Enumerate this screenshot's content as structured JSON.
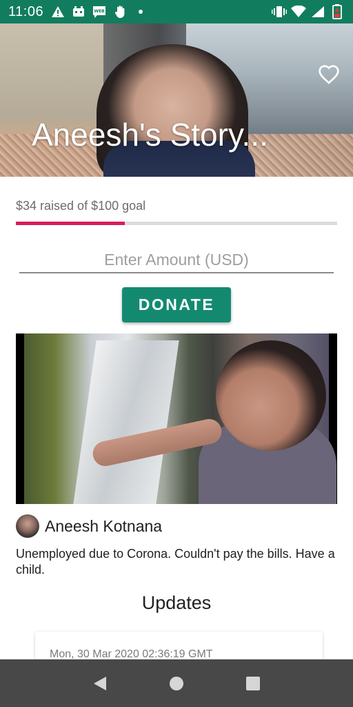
{
  "status_bar": {
    "time": "11:06",
    "left_icons": [
      "alert-icon",
      "bot-icon",
      "webtoon-icon",
      "hand-icon",
      "dot-icon"
    ],
    "right_icons": [
      "vibrate-icon",
      "wifi-icon",
      "signal-icon",
      "battery-low-icon"
    ],
    "background": "#127d5e"
  },
  "hero": {
    "title": "Aneesh's Story..."
  },
  "fundraising": {
    "raised_text": "$34 raised of $100 goal",
    "raised": 34,
    "goal": 100,
    "progress_fraction": 0.34,
    "accent_color": "#d81b60"
  },
  "donation": {
    "amount_placeholder": "Enter Amount (USD)",
    "amount_value": "",
    "donate_label": "DONATE",
    "button_color": "#138a70"
  },
  "story": {
    "author_name": "Aneesh Kotnana",
    "text": "Unemployed due to Corona. Couldn't pay the bills. Have a child."
  },
  "updates": {
    "heading": "Updates",
    "items": [
      {
        "date": "Mon, 30 Mar 2020 02:36:19 GMT"
      }
    ]
  },
  "nav_bar": {
    "buttons": [
      "back-icon",
      "home-icon",
      "recents-icon"
    ]
  }
}
